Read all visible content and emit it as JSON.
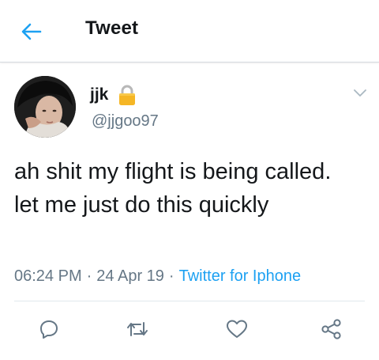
{
  "header": {
    "title": "Tweet",
    "back_icon": "arrow-left-icon",
    "accent_color": "#1da1f2"
  },
  "tweet": {
    "display_name": "jjk",
    "protected_icon": "lock-icon",
    "handle": "@jjgoo97",
    "text": "ah shit my flight is being called. let me just do this quickly",
    "time": "06:24 PM",
    "date": "24 Apr 19",
    "separator": "·",
    "source": "Twitter for Iphone"
  },
  "actions": [
    {
      "name": "reply",
      "icon": "comment-icon"
    },
    {
      "name": "retweet",
      "icon": "retweet-icon"
    },
    {
      "name": "like",
      "icon": "heart-icon"
    },
    {
      "name": "share",
      "icon": "share-icon"
    }
  ]
}
